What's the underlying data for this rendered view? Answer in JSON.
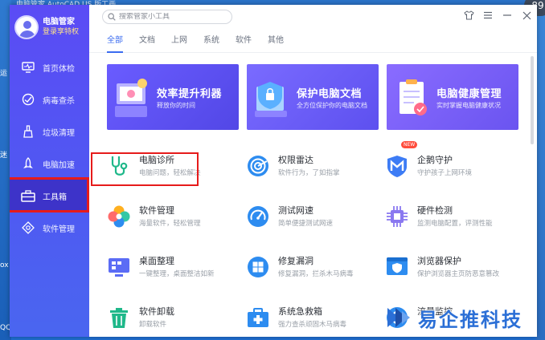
{
  "desktop": {
    "top_strip_text": "电脑管家    AutoCAD    US 版工画",
    "left_labels": [
      "运",
      "迷",
      "ox",
      "QQ"
    ],
    "weather_badge": "89"
  },
  "app": {
    "name": "电脑管家",
    "login_text": "登录享特权"
  },
  "sidebar": {
    "items": [
      {
        "label": "首页体检",
        "icon": "monitor-icon"
      },
      {
        "label": "病毒查杀",
        "icon": "virus-scan-icon"
      },
      {
        "label": "垃圾清理",
        "icon": "broom-icon"
      },
      {
        "label": "电脑加速",
        "icon": "rocket-icon"
      },
      {
        "label": "工具箱",
        "icon": "toolbox-icon",
        "active": true
      },
      {
        "label": "软件管理",
        "icon": "software-icon"
      }
    ]
  },
  "search": {
    "placeholder": "搜索管家小工具"
  },
  "window_controls": [
    "skin-icon",
    "menu-icon",
    "minimize-icon",
    "close-icon"
  ],
  "tabs": [
    {
      "label": "全部",
      "active": true
    },
    {
      "label": "文档"
    },
    {
      "label": "上网"
    },
    {
      "label": "系统"
    },
    {
      "label": "软件"
    },
    {
      "label": "其他"
    }
  ],
  "banners": [
    {
      "title": "效率提升利器",
      "subtitle": "释放你的时间"
    },
    {
      "title": "保护电脑文档",
      "subtitle": "全方位保护你的电脑文档"
    },
    {
      "title": "电脑健康管理",
      "subtitle": "实时掌握电脑健康状况"
    }
  ],
  "tools": [
    [
      {
        "name": "电脑诊所",
        "desc": "电脑问题，轻松解决",
        "icon": "stethoscope-icon",
        "color": "#1fb88a"
      },
      {
        "name": "权限雷达",
        "desc": "软件行为，了如指掌",
        "icon": "radar-icon",
        "color": "#2d8cf0"
      },
      {
        "name": "企鹅守护",
        "desc": "守护孩子上网环境",
        "icon": "shield-m-icon",
        "color": "#3d7cf5",
        "badge": "NEW"
      }
    ],
    [
      {
        "name": "软件管理",
        "desc": "海量软件，轻松管理",
        "icon": "flower-icon",
        "color": "#f5a623"
      },
      {
        "name": "测试网速",
        "desc": "简单便捷测试网速",
        "icon": "speedometer-icon",
        "color": "#2d8cf0"
      },
      {
        "name": "硬件检测",
        "desc": "监测电脑配置，评测性能",
        "icon": "chip-icon",
        "color": "#8a78f0"
      }
    ],
    [
      {
        "name": "桌面整理",
        "desc": "一键整理，桌面整洁如新",
        "icon": "desktop-icon",
        "color": "#5b6cf5"
      },
      {
        "name": "修复漏洞",
        "desc": "修复漏洞，拦杀木马病毒",
        "icon": "windows-icon",
        "color": "#2d8cf0"
      },
      {
        "name": "浏览器保护",
        "desc": "保护浏览器主页防恶意篡改",
        "icon": "browser-shield-icon",
        "color": "#2d8cf0"
      }
    ],
    [
      {
        "name": "软件卸载",
        "desc": "卸载软件",
        "icon": "trash-icon",
        "color": "#1fb88a"
      },
      {
        "name": "系统急救箱",
        "desc": "强力查杀顽固木马病毒",
        "icon": "first-aid-icon",
        "color": "#2d8cf0"
      },
      {
        "name": "流量监控",
        "desc": "",
        "icon": "traffic-icon",
        "color": "#2d8cf0"
      }
    ]
  ],
  "watermark": {
    "text": "易企推科技"
  }
}
